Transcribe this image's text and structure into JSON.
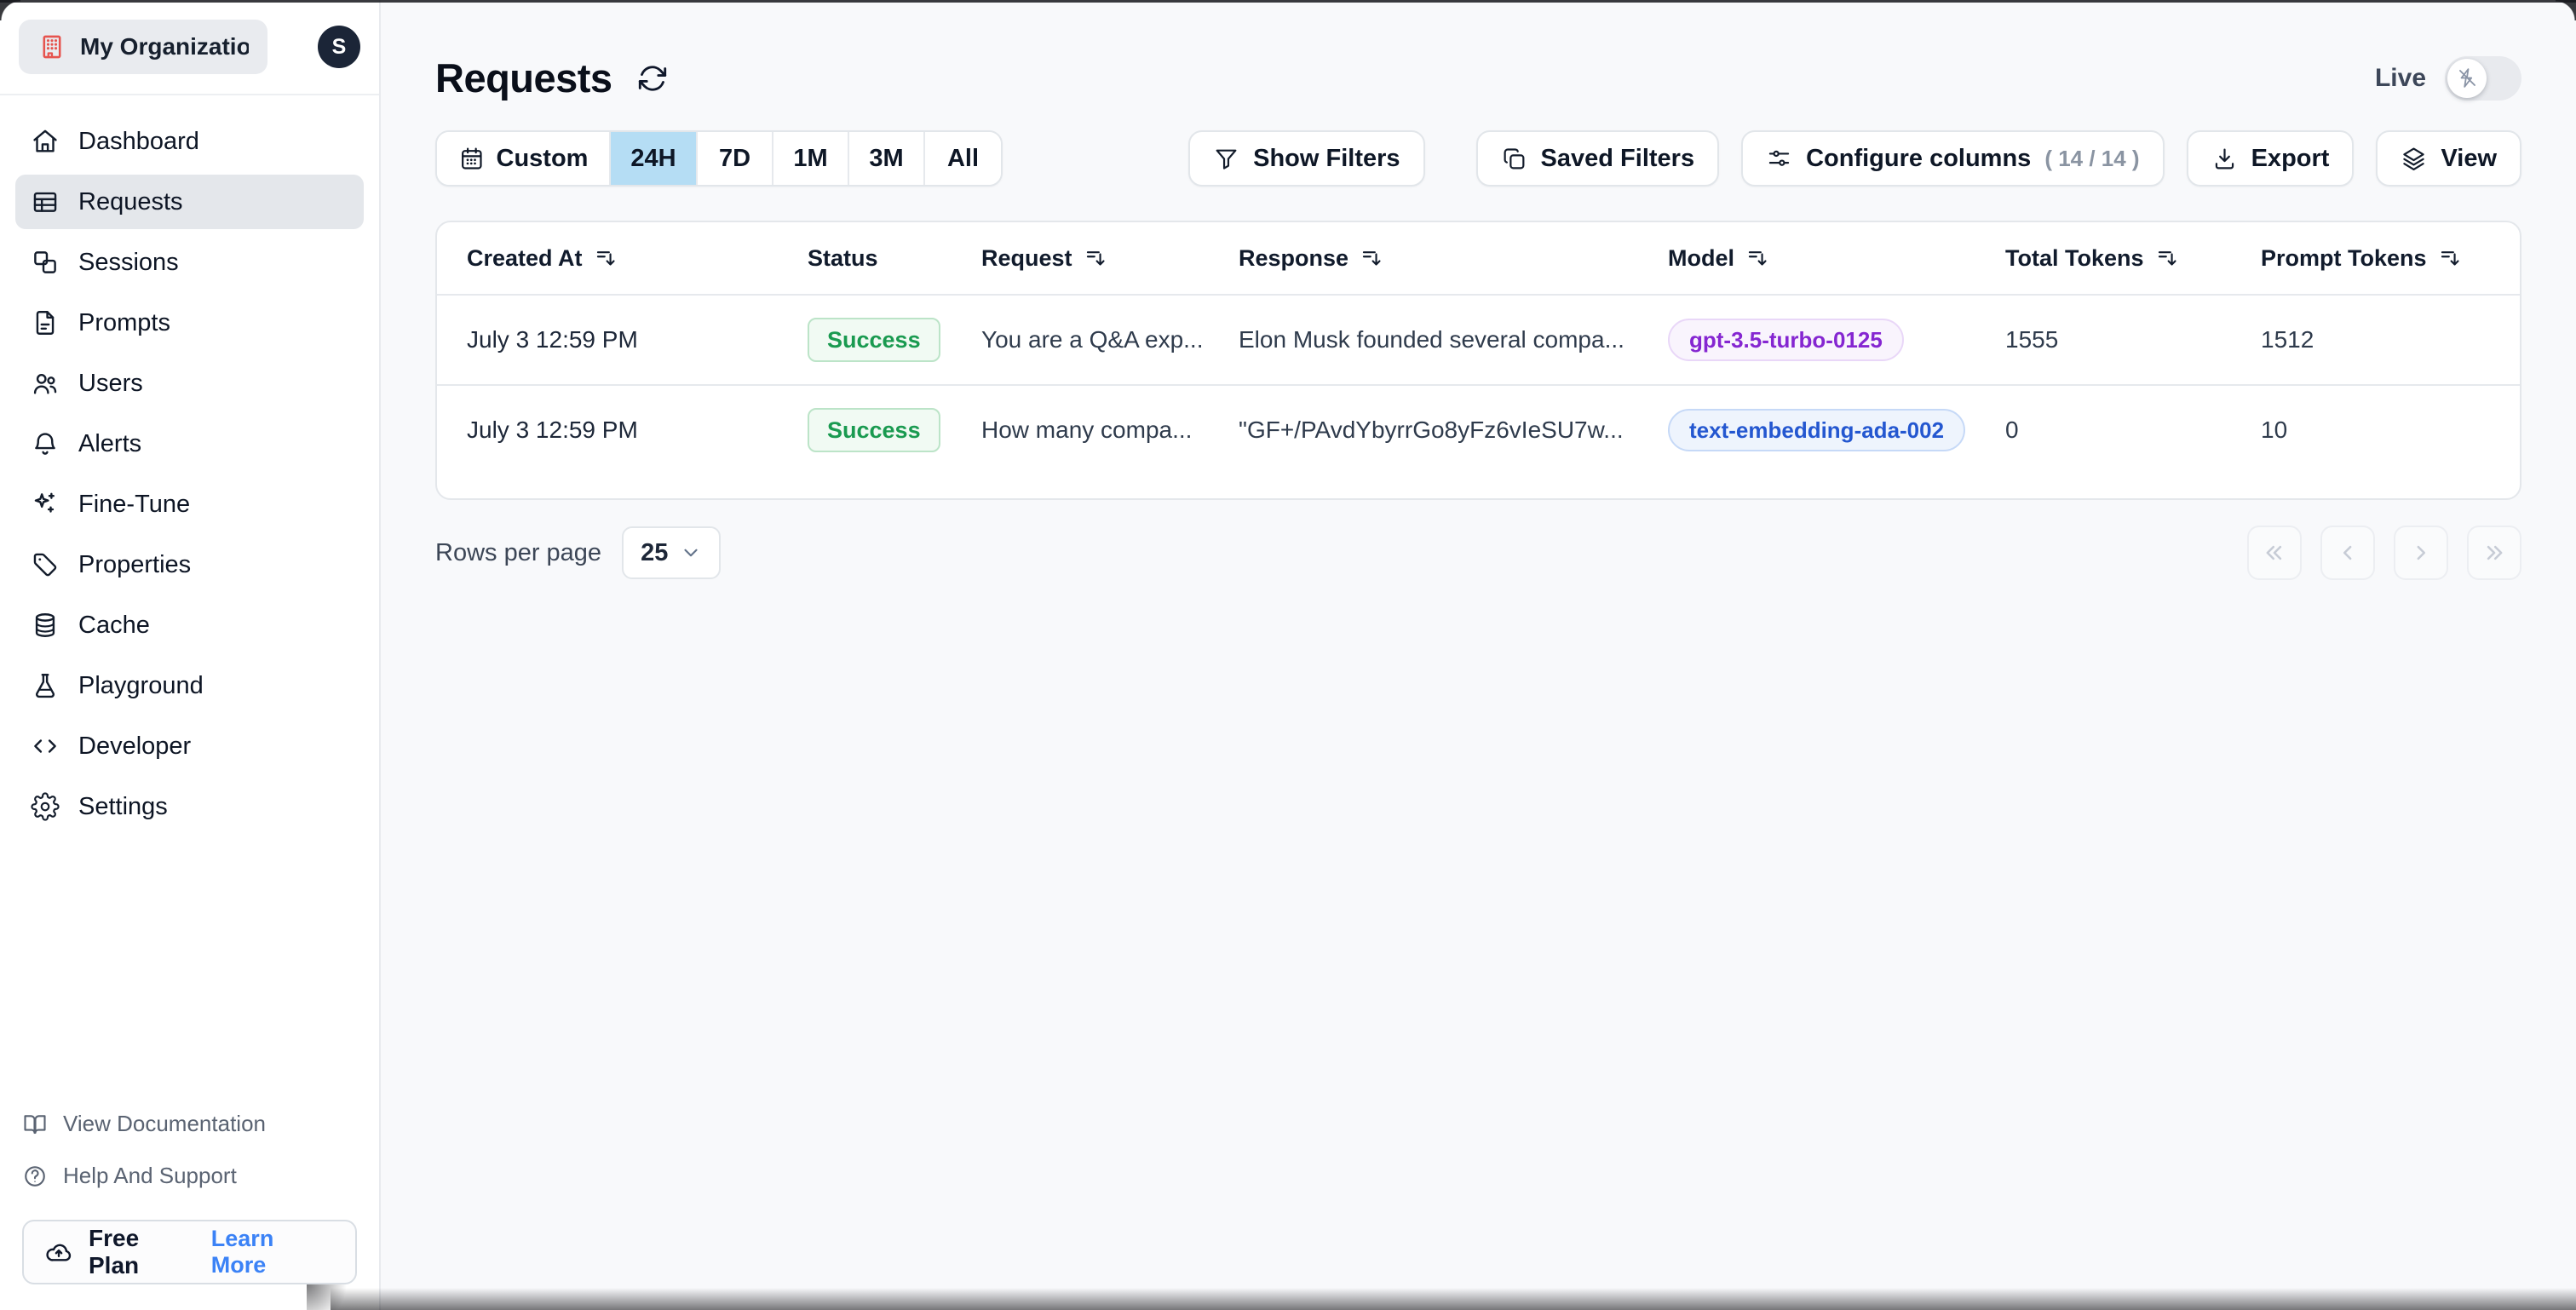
{
  "org": {
    "name": "My Organizatio...",
    "avatar_initial": "S"
  },
  "sidebar": {
    "items": [
      {
        "icon": "home-icon",
        "label": "Dashboard"
      },
      {
        "icon": "table-icon",
        "label": "Requests",
        "selected": true
      },
      {
        "icon": "sessions-icon",
        "label": "Sessions"
      },
      {
        "icon": "document-icon",
        "label": "Prompts"
      },
      {
        "icon": "users-icon",
        "label": "Users"
      },
      {
        "icon": "bell-icon",
        "label": "Alerts"
      },
      {
        "icon": "sparkles-icon",
        "label": "Fine-Tune"
      },
      {
        "icon": "tag-icon",
        "label": "Properties"
      },
      {
        "icon": "database-icon",
        "label": "Cache"
      },
      {
        "icon": "flask-icon",
        "label": "Playground"
      },
      {
        "icon": "code-icon",
        "label": "Developer"
      },
      {
        "icon": "gear-icon",
        "label": "Settings"
      }
    ],
    "footer_links": [
      {
        "icon": "book-icon",
        "label": "View Documentation"
      },
      {
        "icon": "help-icon",
        "label": "Help And Support"
      }
    ],
    "plan": {
      "label": "Free Plan",
      "link": "Learn More",
      "icon": "cloud-upload-icon"
    }
  },
  "header": {
    "title": "Requests",
    "live_label": "Live",
    "live_on": false
  },
  "toolbar": {
    "time_ranges": {
      "custom": "Custom",
      "h24": "24H",
      "d7": "7D",
      "m1": "1M",
      "m3": "3M",
      "all": "All",
      "selected": "24H"
    },
    "show_filters": "Show Filters",
    "saved_filters": "Saved Filters",
    "configure_columns": "Configure columns",
    "configure_count": "( 14 / 14 )",
    "export": "Export",
    "view": "View"
  },
  "table": {
    "columns": [
      {
        "label": "Created At",
        "sortable": true
      },
      {
        "label": "Status",
        "sortable": false
      },
      {
        "label": "Request",
        "sortable": true
      },
      {
        "label": "Response",
        "sortable": true
      },
      {
        "label": "Model",
        "sortable": true
      },
      {
        "label": "Total Tokens",
        "sortable": true
      },
      {
        "label": "Prompt Tokens",
        "sortable": true
      }
    ],
    "rows": [
      {
        "created_at": "July 3 12:59 PM",
        "status": "Success",
        "request": "You are a Q&A exp...",
        "response": "Elon Musk founded several compa...",
        "model": "gpt-3.5-turbo-0125",
        "model_color": "purple",
        "total_tokens": "1555",
        "prompt_tokens": "1512"
      },
      {
        "created_at": "July 3 12:59 PM",
        "status": "Success",
        "request": "How many compa...",
        "response": "\"GF+/PAvdYbyrrGo8yFz6vIeSU7w...",
        "model": "text-embedding-ada-002",
        "model_color": "blue",
        "total_tokens": "0",
        "prompt_tokens": "10"
      }
    ]
  },
  "pagination": {
    "rows_per_page_label": "Rows per page",
    "rows_per_page_value": "25"
  },
  "colors": {
    "accent_selected_range": "#b5ddf4",
    "success_text": "#1a9a50",
    "model_purple": "#8526d1",
    "model_blue": "#2457d0",
    "learn_more_link": "#3b82f6",
    "org_icon_red": "#e6544f",
    "avatar_bg": "#1b2537",
    "page_bg": "#f8f9fb"
  }
}
